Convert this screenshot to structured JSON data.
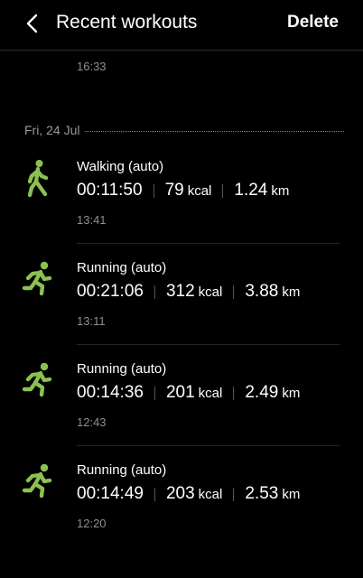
{
  "header": {
    "title": "Recent workouts",
    "delete_label": "Delete"
  },
  "previous_item": {
    "time": "16:33"
  },
  "day_group": {
    "date": "Fri, 24 Jul",
    "items": [
      {
        "name": "Walking (auto)",
        "duration": "00:11:50",
        "kcal": "79",
        "kcal_unit": "kcal",
        "distance": "1.24",
        "distance_unit": "km",
        "time": "13:41",
        "icon": "walking-icon"
      },
      {
        "name": "Running (auto)",
        "duration": "00:21:06",
        "kcal": "312",
        "kcal_unit": "kcal",
        "distance": "3.88",
        "distance_unit": "km",
        "time": "13:11",
        "icon": "running-icon"
      },
      {
        "name": "Running (auto)",
        "duration": "00:14:36",
        "kcal": "201",
        "kcal_unit": "kcal",
        "distance": "2.49",
        "distance_unit": "km",
        "time": "12:43",
        "icon": "running-icon"
      },
      {
        "name": "Running (auto)",
        "duration": "00:14:49",
        "kcal": "203",
        "kcal_unit": "kcal",
        "distance": "2.53",
        "distance_unit": "km",
        "time": "12:20",
        "icon": "running-icon"
      }
    ]
  },
  "colors": {
    "accent": "#8cc152",
    "background": "#000000"
  }
}
